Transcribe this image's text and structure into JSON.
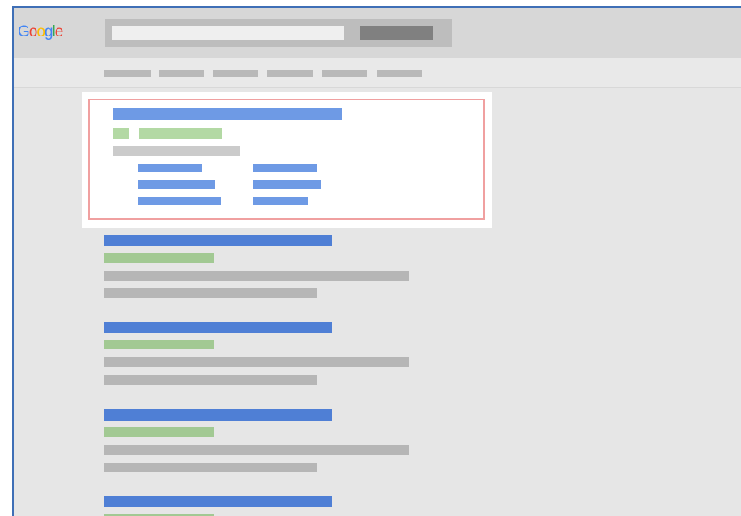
{
  "header": {
    "logo_text": "Google",
    "logo_letters": [
      {
        "char": "G",
        "color": "#4285f4"
      },
      {
        "char": "o",
        "color": "#ea4335"
      },
      {
        "char": "o",
        "color": "#fbbc05"
      },
      {
        "char": "g",
        "color": "#4285f4"
      },
      {
        "char": "l",
        "color": "#34a853"
      },
      {
        "char": "e",
        "color": "#ea4335"
      }
    ],
    "search": {
      "value": "",
      "placeholder": ""
    },
    "search_button_label": ""
  },
  "nav": {
    "tabs": [
      {
        "label": ""
      },
      {
        "label": ""
      },
      {
        "label": ""
      },
      {
        "label": ""
      },
      {
        "label": ""
      },
      {
        "label": ""
      }
    ]
  },
  "featured_result": {
    "title": "",
    "url": "",
    "snippet": "",
    "sitelinks": [
      {
        "label": ""
      },
      {
        "label": ""
      },
      {
        "label": ""
      },
      {
        "label": ""
      },
      {
        "label": ""
      },
      {
        "label": ""
      }
    ]
  },
  "results": [
    {
      "title": "",
      "url": "",
      "snippet_line_1": "",
      "snippet_line_2": ""
    },
    {
      "title": "",
      "url": "",
      "snippet_line_1": "",
      "snippet_line_2": ""
    },
    {
      "title": "",
      "url": "",
      "snippet_line_1": "",
      "snippet_line_2": ""
    },
    {
      "title": "",
      "url": "",
      "snippet_line_1": "",
      "snippet_line_2": ""
    }
  ],
  "colors": {
    "accent_border": "#3f6fb6",
    "link_blue": "#4f7fd5",
    "url_green": "#a2c993",
    "snippet_grey": "#b6b6b6",
    "highlight_border": "#f0a0a0"
  }
}
